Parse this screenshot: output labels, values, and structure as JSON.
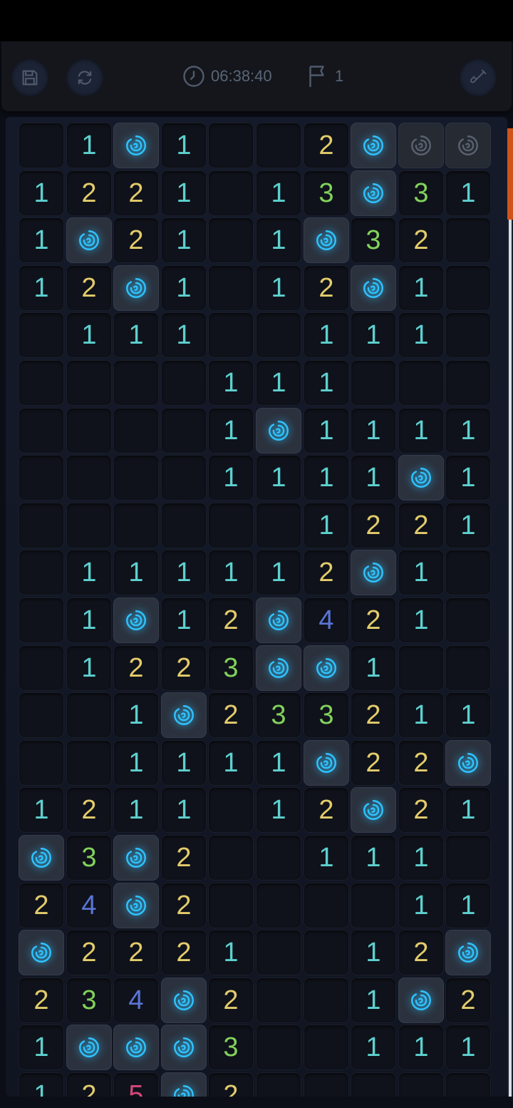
{
  "toolbar": {
    "timer": "06:38:40",
    "flag_count": "1"
  },
  "colors": {
    "accent": "#d0541a",
    "number_1": "#5ed0d0",
    "number_2": "#e3cc6c",
    "number_3": "#82d25c",
    "number_4": "#5a75d6",
    "number_5": "#d8477b",
    "mine_glow": "#2fc3ff"
  },
  "icons": {
    "save": "save-icon",
    "restart": "restart-icon",
    "clock": "clock-icon",
    "flag": "flag-icon",
    "settings": "shovel-icon",
    "mine": "rose-icon"
  },
  "board": {
    "columns": 10,
    "legend": "'' = empty revealed, 'M' = revealed rose, 'H' = dim unrevealed rose, digits = numbers",
    "rows": [
      [
        "",
        "1",
        "M",
        "1",
        "",
        "",
        "2",
        "M",
        "H",
        "H"
      ],
      [
        "1",
        "2",
        "2",
        "1",
        "",
        "1",
        "3",
        "M",
        "3",
        "1"
      ],
      [
        "1",
        "M",
        "2",
        "1",
        "",
        "1",
        "M",
        "3",
        "2",
        ""
      ],
      [
        "1",
        "2",
        "M",
        "1",
        "",
        "1",
        "2",
        "M",
        "1",
        ""
      ],
      [
        "",
        "1",
        "1",
        "1",
        "",
        "",
        "1",
        "1",
        "1",
        ""
      ],
      [
        "",
        "",
        "",
        "",
        "1",
        "1",
        "1",
        "",
        "",
        ""
      ],
      [
        "",
        "",
        "",
        "",
        "1",
        "M",
        "1",
        "1",
        "1",
        "1"
      ],
      [
        "",
        "",
        "",
        "",
        "1",
        "1",
        "1",
        "1",
        "M",
        "1"
      ],
      [
        "",
        "",
        "",
        "",
        "",
        "",
        "1",
        "2",
        "2",
        "1"
      ],
      [
        "",
        "1",
        "1",
        "1",
        "1",
        "1",
        "2",
        "M",
        "1",
        ""
      ],
      [
        "",
        "1",
        "M",
        "1",
        "2",
        "M",
        "4",
        "2",
        "1",
        ""
      ],
      [
        "",
        "1",
        "2",
        "2",
        "3",
        "M",
        "M",
        "1",
        "",
        ""
      ],
      [
        "",
        "",
        "1",
        "M",
        "2",
        "3",
        "3",
        "2",
        "1",
        "1"
      ],
      [
        "",
        "",
        "1",
        "1",
        "1",
        "1",
        "M",
        "2",
        "2",
        "M"
      ],
      [
        "1",
        "2",
        "1",
        "1",
        "",
        "1",
        "2",
        "M",
        "2",
        "1"
      ],
      [
        "M",
        "3",
        "M",
        "2",
        "",
        "",
        "1",
        "1",
        "1",
        ""
      ],
      [
        "2",
        "4",
        "M",
        "2",
        "",
        "",
        "",
        "",
        "1",
        "1"
      ],
      [
        "M",
        "2",
        "2",
        "2",
        "1",
        "",
        "",
        "1",
        "2",
        "M"
      ],
      [
        "2",
        "3",
        "4",
        "M",
        "2",
        "",
        "",
        "1",
        "M",
        "2"
      ],
      [
        "1",
        "M",
        "M",
        "M",
        "3",
        "",
        "",
        "1",
        "1",
        "1"
      ],
      [
        "1",
        "2",
        "5",
        "M",
        "2",
        "",
        "",
        "",
        "",
        ""
      ]
    ]
  }
}
